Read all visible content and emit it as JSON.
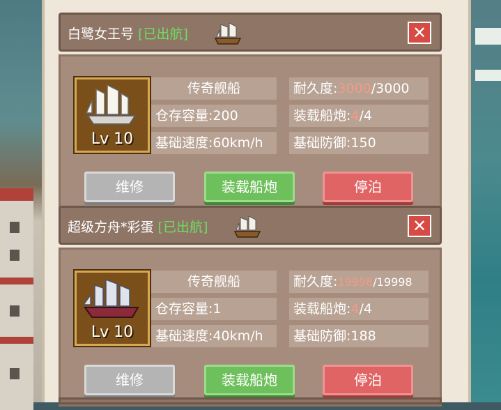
{
  "ships": [
    {
      "name": "白鹭女王号",
      "status": "[已出航]",
      "level": "Lv 10",
      "rarity": "传奇舰船",
      "storage_label": "仓存容量:",
      "storage_value": "200",
      "speed_label": "基础速度:",
      "speed_value": "60km/h",
      "durability_label": "耐久度:",
      "durability_current": "3000",
      "durability_max": "/3000",
      "cannon_label": "装载船炮:",
      "cannon_current": "4",
      "cannon_max": "/4",
      "defense_label": "基础防御:",
      "defense_value": "150"
    },
    {
      "name": "超级方舟*彩蛋",
      "status": "[已出航]",
      "level": "Lv 10",
      "rarity": "传奇舰船",
      "storage_label": "仓存容量:",
      "storage_value": "1",
      "speed_label": "基础速度:",
      "speed_value": "40km/h",
      "durability_label": "耐久度:",
      "durability_current": "19998",
      "durability_max": "/19998",
      "cannon_label": "装载船炮:",
      "cannon_current": "4",
      "cannon_max": "/4",
      "defense_label": "基础防御:",
      "defense_value": "188"
    }
  ],
  "buttons": {
    "repair": "维修",
    "load_cannon": "装载船炮",
    "dock": "停泊",
    "close": "✕"
  },
  "colors": {
    "status_green": "#6ddf5f",
    "highlight_pink": "#f29b87",
    "header_brown": "#8f7566",
    "close_red": "#d84a44"
  },
  "icons": [
    "ship-icon",
    "close-icon"
  ]
}
